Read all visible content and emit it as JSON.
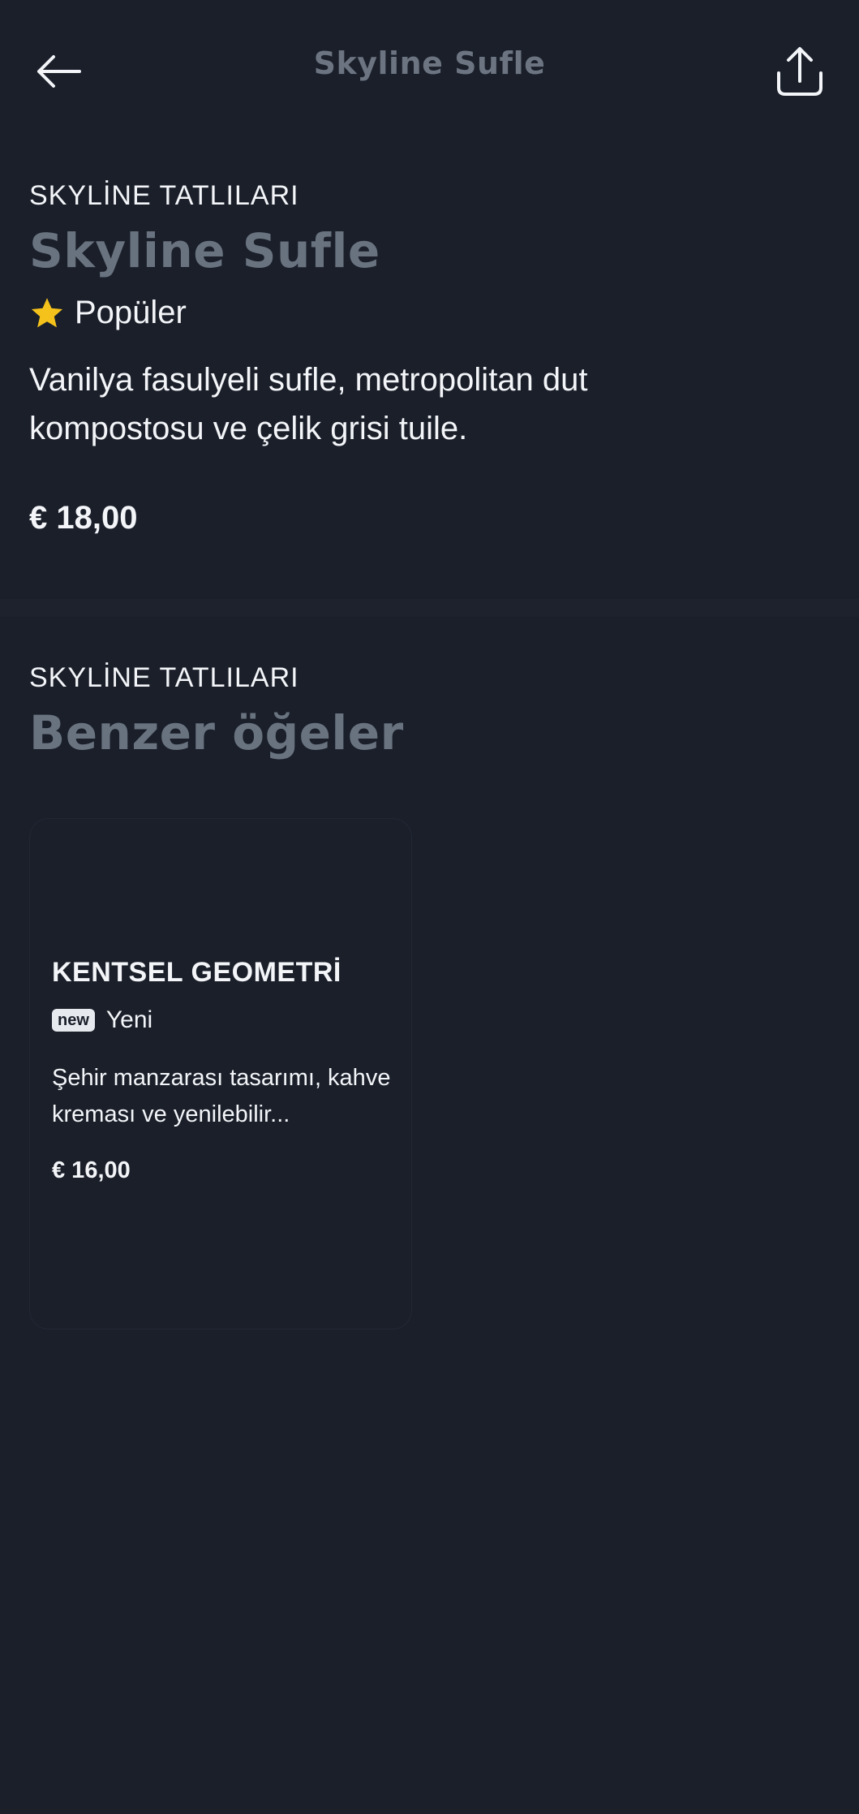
{
  "header": {
    "title": "Skyline Sufle",
    "back_icon": "arrow-left-icon",
    "share_icon": "share-icon"
  },
  "item": {
    "category": "SKYLİNE TATLILARI",
    "title": "Skyline Sufle",
    "badge_icon": "star-icon",
    "badge": "Popüler",
    "description": "Vanilya fasulyeli sufle, metropolitan dut kompostosu ve çelik grisi tuile.",
    "price": "€ 18,00"
  },
  "similar": {
    "category": "SKYLİNE TATLILARI",
    "title": "Benzer öğeler",
    "items": [
      {
        "title": "KENTSEL GEOMETRİ",
        "tag": "new",
        "badge": "Yeni",
        "description": "Şehir manzarası tasarımı, kahve kreması ve yenilebilir...",
        "price": "€ 16,00"
      }
    ]
  },
  "colors": {
    "background": "#1a1f2a",
    "muted_title": "#697380",
    "text": "#f3f5f8",
    "star": "#f5c21b"
  }
}
